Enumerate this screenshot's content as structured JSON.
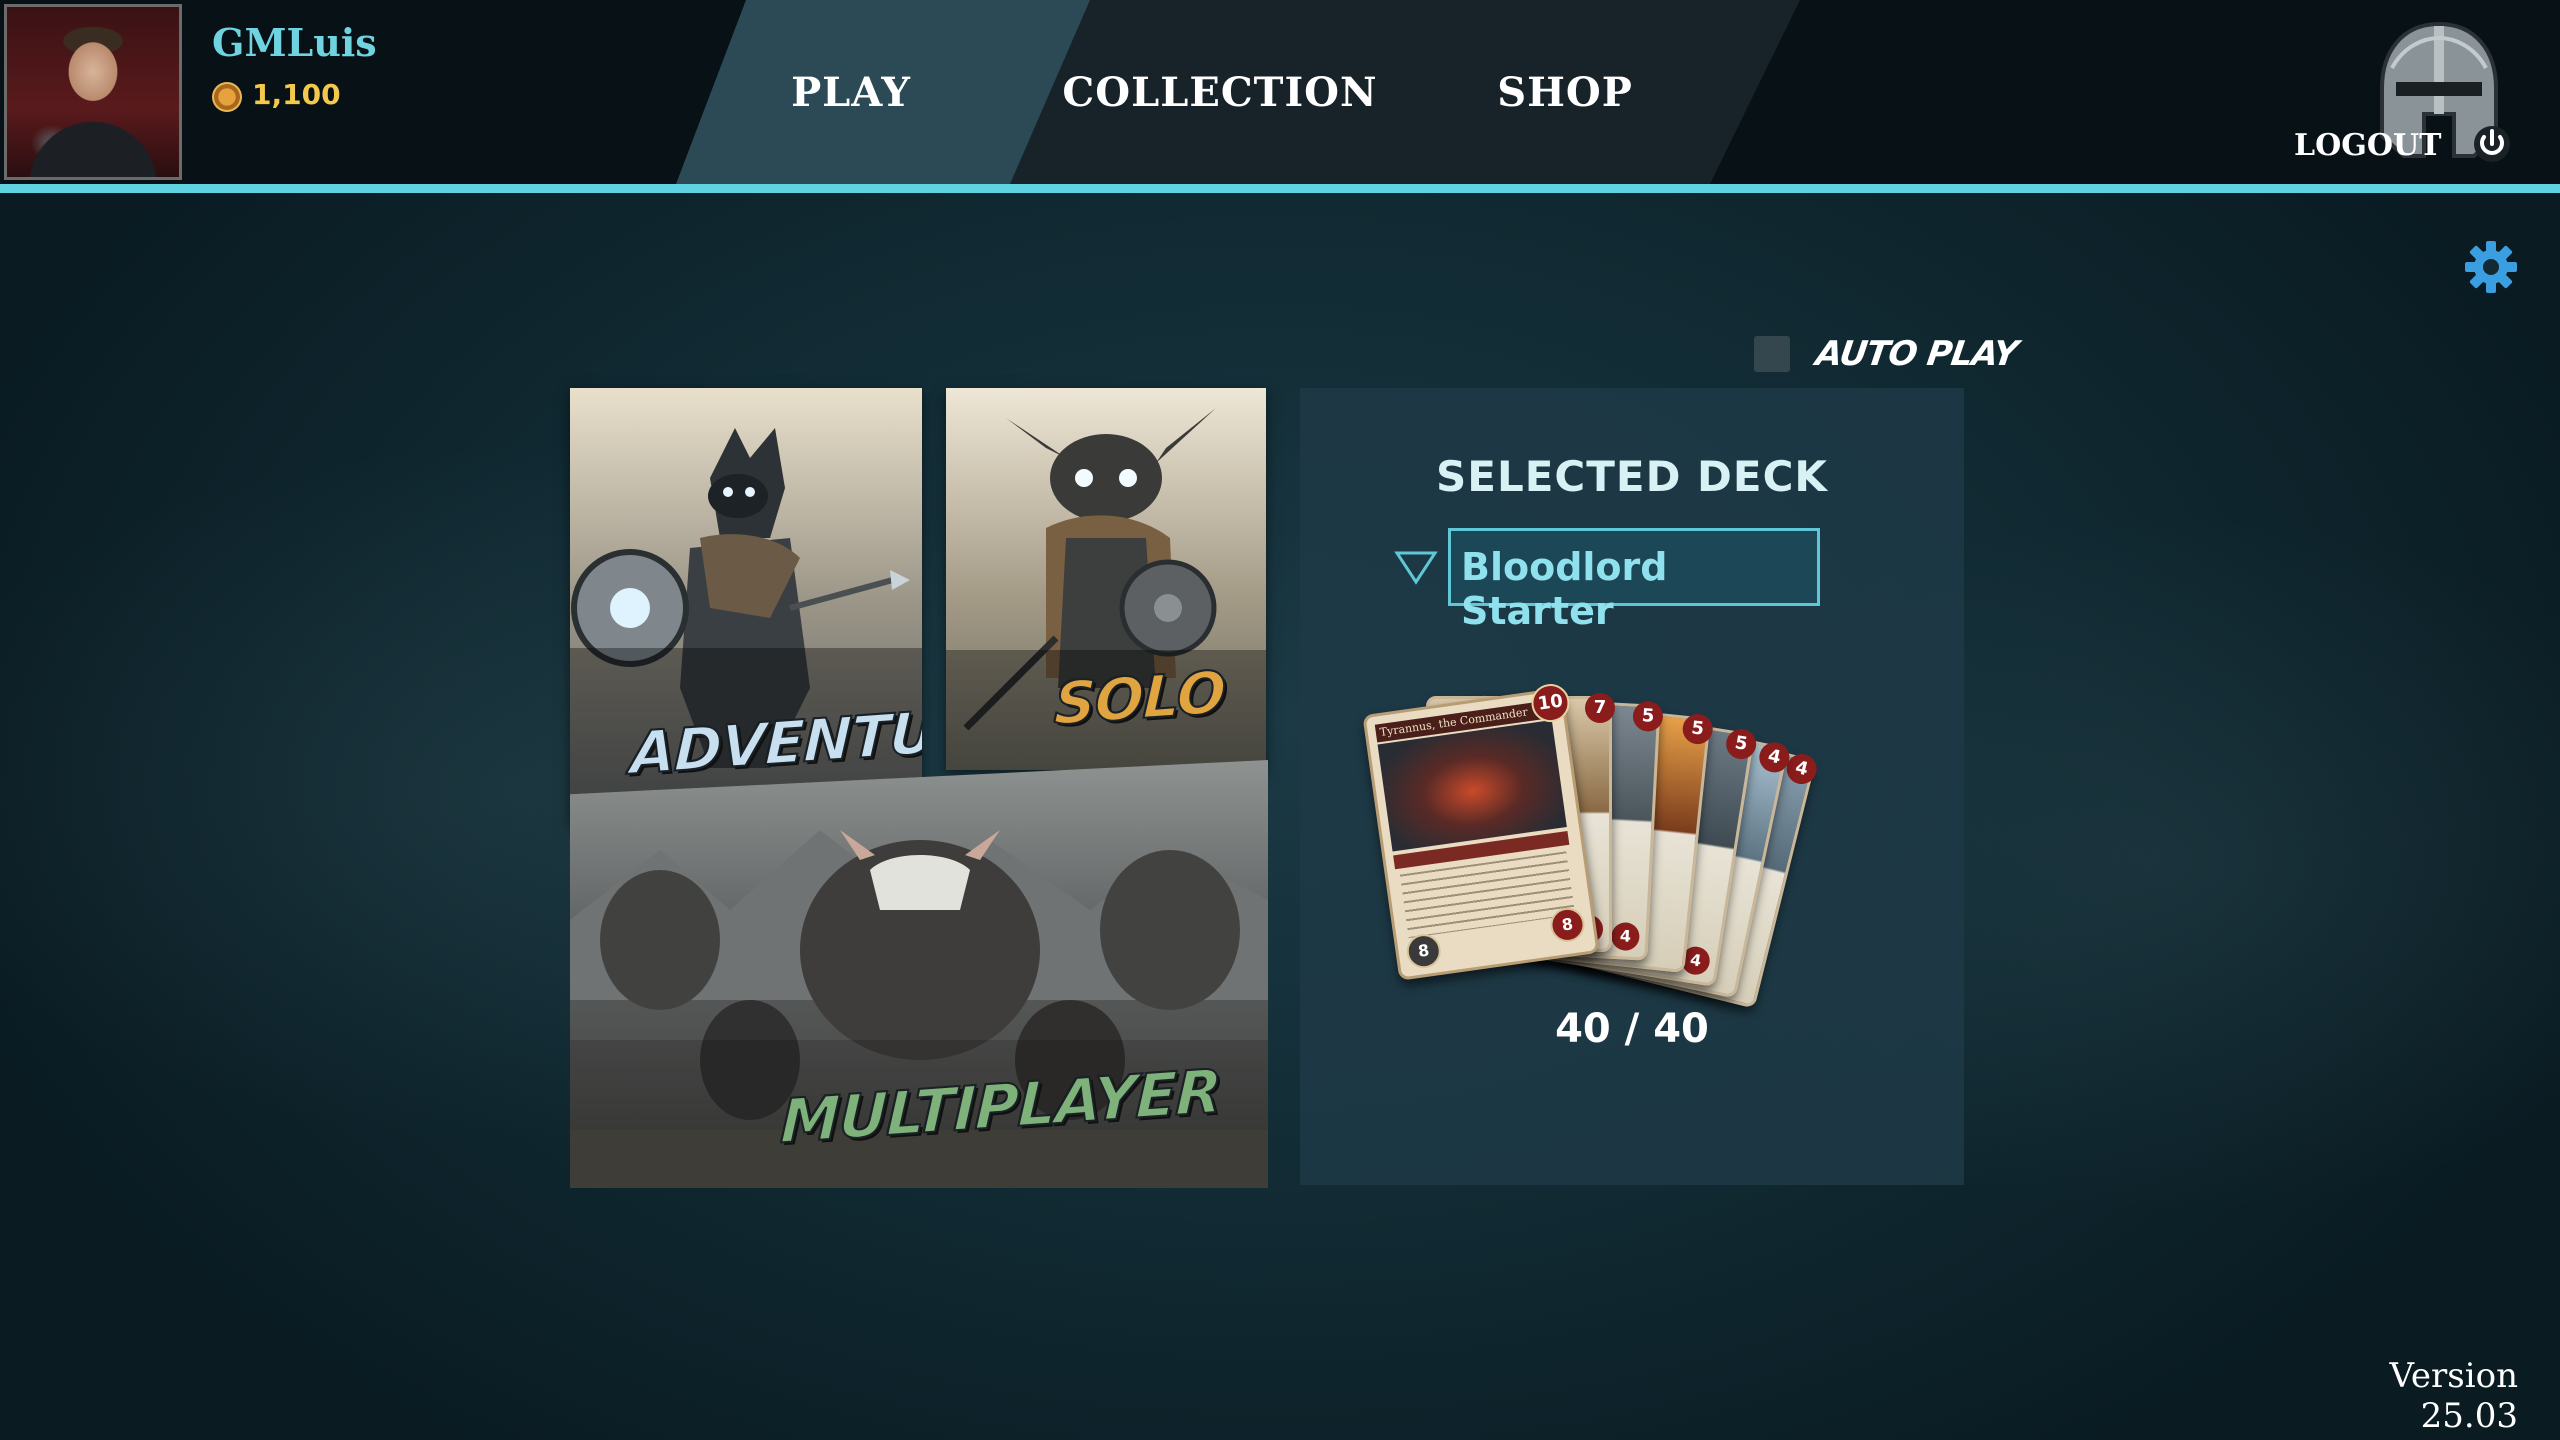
{
  "player": {
    "name": "GMLuis",
    "coins": "1,100"
  },
  "nav": {
    "tabs": [
      {
        "label": "PLAY",
        "active": true
      },
      {
        "label": "COLLECTION",
        "active": false
      },
      {
        "label": "SHOP",
        "active": false
      }
    ],
    "logout_label": "LOGOUT"
  },
  "autoplay": {
    "label": "AUTO PLAY",
    "checked": false
  },
  "modes": {
    "adventure": "ADVENTURE",
    "solo": "SOLO",
    "multiplayer": "MULTIPLAYER"
  },
  "deck": {
    "title": "SELECTED DECK",
    "selected": "Bloodlord Starter",
    "count": "40 / 40",
    "cards": [
      {
        "name": "Tyrannus, the Commander",
        "cost": "10",
        "attack": "8",
        "health": "8"
      },
      {
        "cost": "7",
        "health": "5"
      },
      {
        "cost": "5",
        "health": "4"
      },
      {
        "cost": "5"
      },
      {
        "cost": "5",
        "health": "4"
      },
      {
        "cost": "4"
      },
      {
        "cost": "4"
      }
    ]
  },
  "version": "Version 25.03",
  "colors": {
    "accent": "#5fd3e2",
    "coin": "#f2c94c",
    "adventure": "#c8dff0",
    "solo": "#e0a540",
    "multiplayer": "#7fb27a"
  }
}
